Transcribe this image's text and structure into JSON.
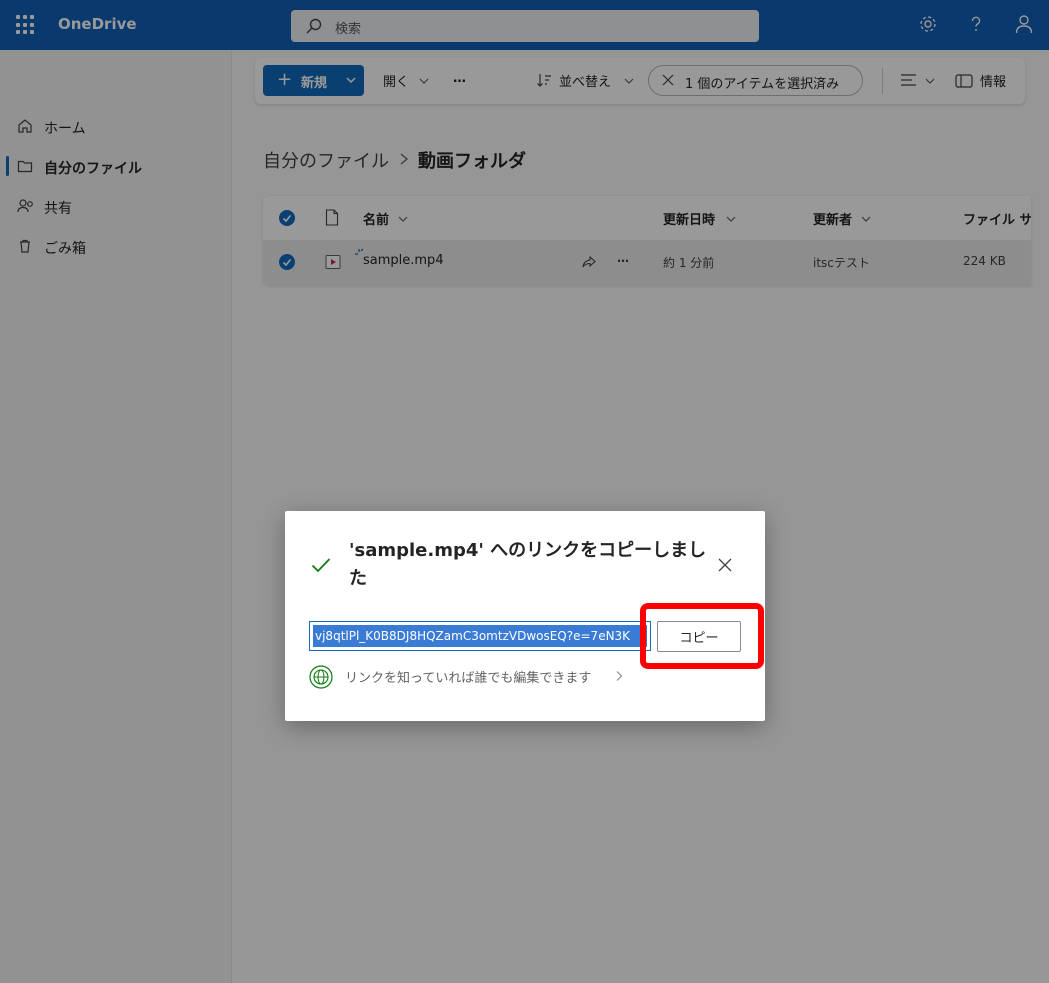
{
  "app": {
    "title": "OneDrive"
  },
  "header": {
    "search_placeholder": "検索"
  },
  "colors": {
    "brand": "#0f60b6",
    "accent": "#0f6cbd",
    "highlight": "#ff0000",
    "success": "#107c10"
  },
  "nav": {
    "items": [
      {
        "label": "ホーム",
        "icon": "home-icon"
      },
      {
        "label": "自分のファイル",
        "icon": "folder-icon",
        "active": true
      },
      {
        "label": "共有",
        "icon": "people-icon"
      },
      {
        "label": "ごみ箱",
        "icon": "trash-icon"
      }
    ]
  },
  "toolbar": {
    "new_label": "新規",
    "open_label": "開く",
    "more_label": "…",
    "sort_label": "並べ替え",
    "selection_label": "1 個のアイテムを選択済み",
    "info_label": "情報"
  },
  "breadcrumb": {
    "parent": "自分のファイル",
    "current": "動画フォルダ"
  },
  "table": {
    "headers": {
      "name": "名前",
      "modified": "更新日時",
      "modified_by": "更新者",
      "size": "ファイル サ"
    },
    "rows": [
      {
        "name": "sample.mp4",
        "modified": "約 1 分前",
        "modified_by": "itscテスト",
        "size": "224 KB"
      }
    ]
  },
  "dialog": {
    "title": "'sample.mp4' へのリンクをコピーしました",
    "link_value": "vj8qtlPl_K0B8DJ8HQZamC3omtzVDwosEQ?e=7eN3K",
    "copy_label": "コピー",
    "permission_text": "リンクを知っていれば誰でも編集できます"
  }
}
